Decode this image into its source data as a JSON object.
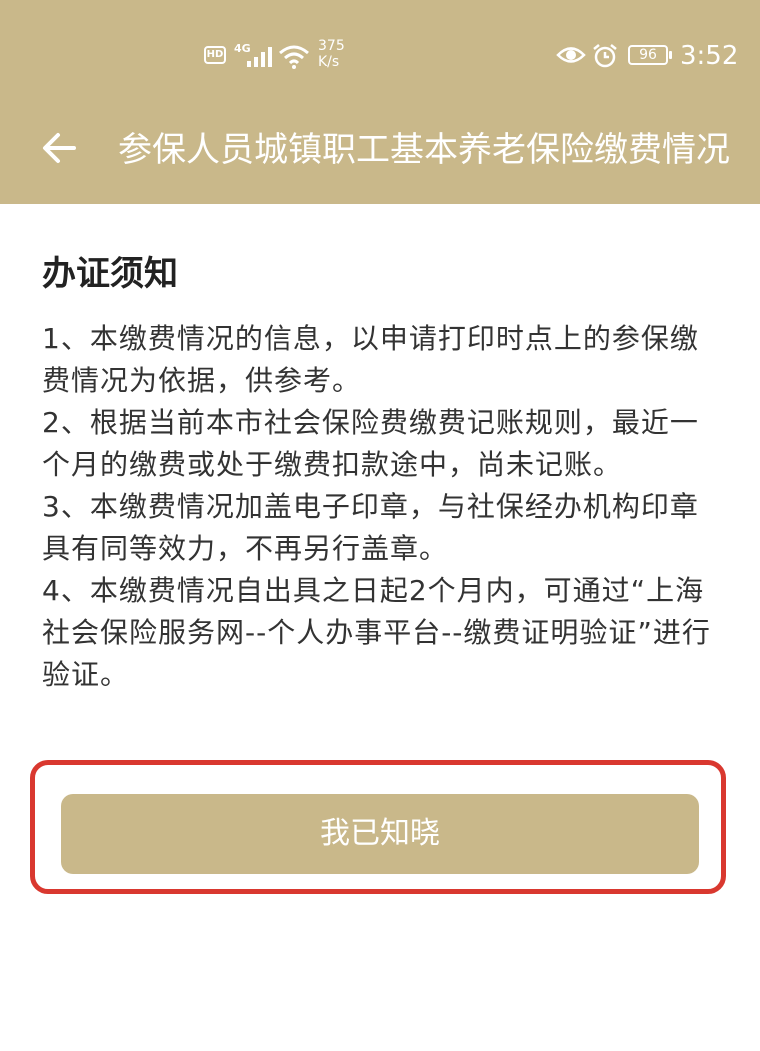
{
  "status_bar": {
    "hd_label": "HD",
    "network_label": "4G",
    "speed_value": "375",
    "speed_unit": "K/s",
    "battery_level": "96",
    "time": "3:52",
    "icons": [
      "hd-icon",
      "signal-icon",
      "wifi-icon",
      "eye-icon",
      "alarm-icon",
      "battery-icon"
    ]
  },
  "header": {
    "back_icon": "arrow-left-icon",
    "title": "参保人员城镇职工基本养老保险缴费情况"
  },
  "notice": {
    "title": "办证须知",
    "items": [
      "1、本缴费情况的信息，以申请打印时点上的参保缴费情况为依据，供参考。",
      "2、根据当前本市社会保险费缴费记账规则，最近一个月的缴费或处于缴费扣款途中，尚未记账。",
      "3、本缴费情况加盖电子印章，与社保经办机构印章具有同等效力，不再另行盖章。",
      "4、本缴费情况自出具之日起2个月内，可通过“上海社会保险服务网--个人办事平台--缴费证明验证”进行验证。"
    ]
  },
  "confirm_button": {
    "label": "我已知晓"
  },
  "colors": {
    "header_bg": "#c9b88a",
    "button_bg": "#c9b88a",
    "highlight_border": "#d9382f",
    "text": "#333333"
  }
}
